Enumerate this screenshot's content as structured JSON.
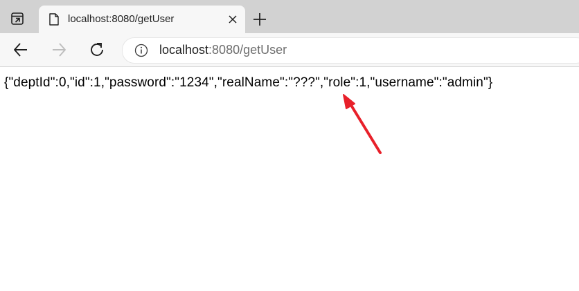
{
  "tab": {
    "title": "localhost:8080/getUser",
    "favicon": "document-icon"
  },
  "toolbar": {
    "back_icon": "arrow-left-icon",
    "forward_icon": "arrow-right-icon",
    "reload_icon": "reload-icon"
  },
  "address_bar": {
    "host": "localhost",
    "rest": ":8080/getUser",
    "info_icon": "info-icon"
  },
  "page": {
    "json_text": "{\"deptId\":0,\"id\":1,\"password\":\"1234\",\"realName\":\"???\",\"role\":1,\"username\":\"admin\"}"
  },
  "annotation": {
    "arrow_color": "#e8202a"
  },
  "colors": {
    "tabstrip_bg": "#d2d2d2",
    "toolbar_bg": "#f7f7f7",
    "page_bg": "#ffffff"
  }
}
